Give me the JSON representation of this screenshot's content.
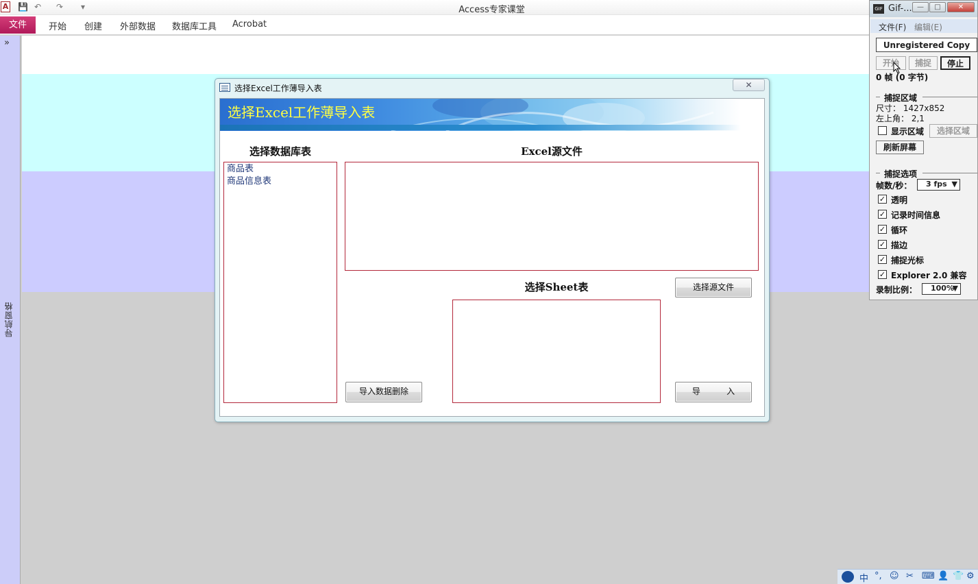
{
  "window": {
    "title": "Access专家课堂",
    "app_icon": "A"
  },
  "qat": {
    "save": "💾",
    "undo": "↶",
    "redo": "↷",
    "customize": "▾"
  },
  "ribbon": {
    "file": "文件",
    "tabs": [
      "开始",
      "创建",
      "外部数据",
      "数据库工具",
      "Acrobat"
    ]
  },
  "nav": {
    "toggle": "»",
    "label": "导航窗格"
  },
  "dialog": {
    "title": "选择Excel工作薄导入表",
    "close": "✕",
    "banner": "选择Excel工作薄导入表",
    "db_tables_header": "选择数据库表",
    "db_tables": [
      "商品表",
      "商品信息表"
    ],
    "excel_header": "Excel源文件",
    "sheet_header": "选择Sheet表",
    "btn_choose_file": "选择源文件",
    "btn_delete_imported": "导入数据删除",
    "btn_import": "导          入"
  },
  "gif": {
    "title": "Gif-...",
    "menu": [
      "文件(F)",
      "编辑(E)"
    ],
    "unregistered": "Unregistered Copy",
    "btn_start": "开始",
    "btn_capture": "捕捉",
    "btn_stop": "停止",
    "frames": "0 帧 (0 字节)",
    "capture_area": "捕捉区域",
    "size": "尺寸： 1427x852",
    "topleft": "左上角： 2,1",
    "show_area": "显示区域",
    "select_area": "选择区域",
    "refresh": "刷新屏幕",
    "capture_options": "捕捉选项",
    "fps_label": "帧数/秒：",
    "fps_value": "3 fps",
    "options": [
      "透明",
      "记录时间信息",
      "循环",
      "描边",
      "捕捉光标",
      "Explorer 2.0 兼容"
    ],
    "scale_label": "录制比例：",
    "scale_value": "100%"
  },
  "tray": {
    "icons": [
      "中",
      "°,",
      "☺",
      "✂",
      "⌨",
      "👤",
      "👕",
      "⚙"
    ]
  }
}
